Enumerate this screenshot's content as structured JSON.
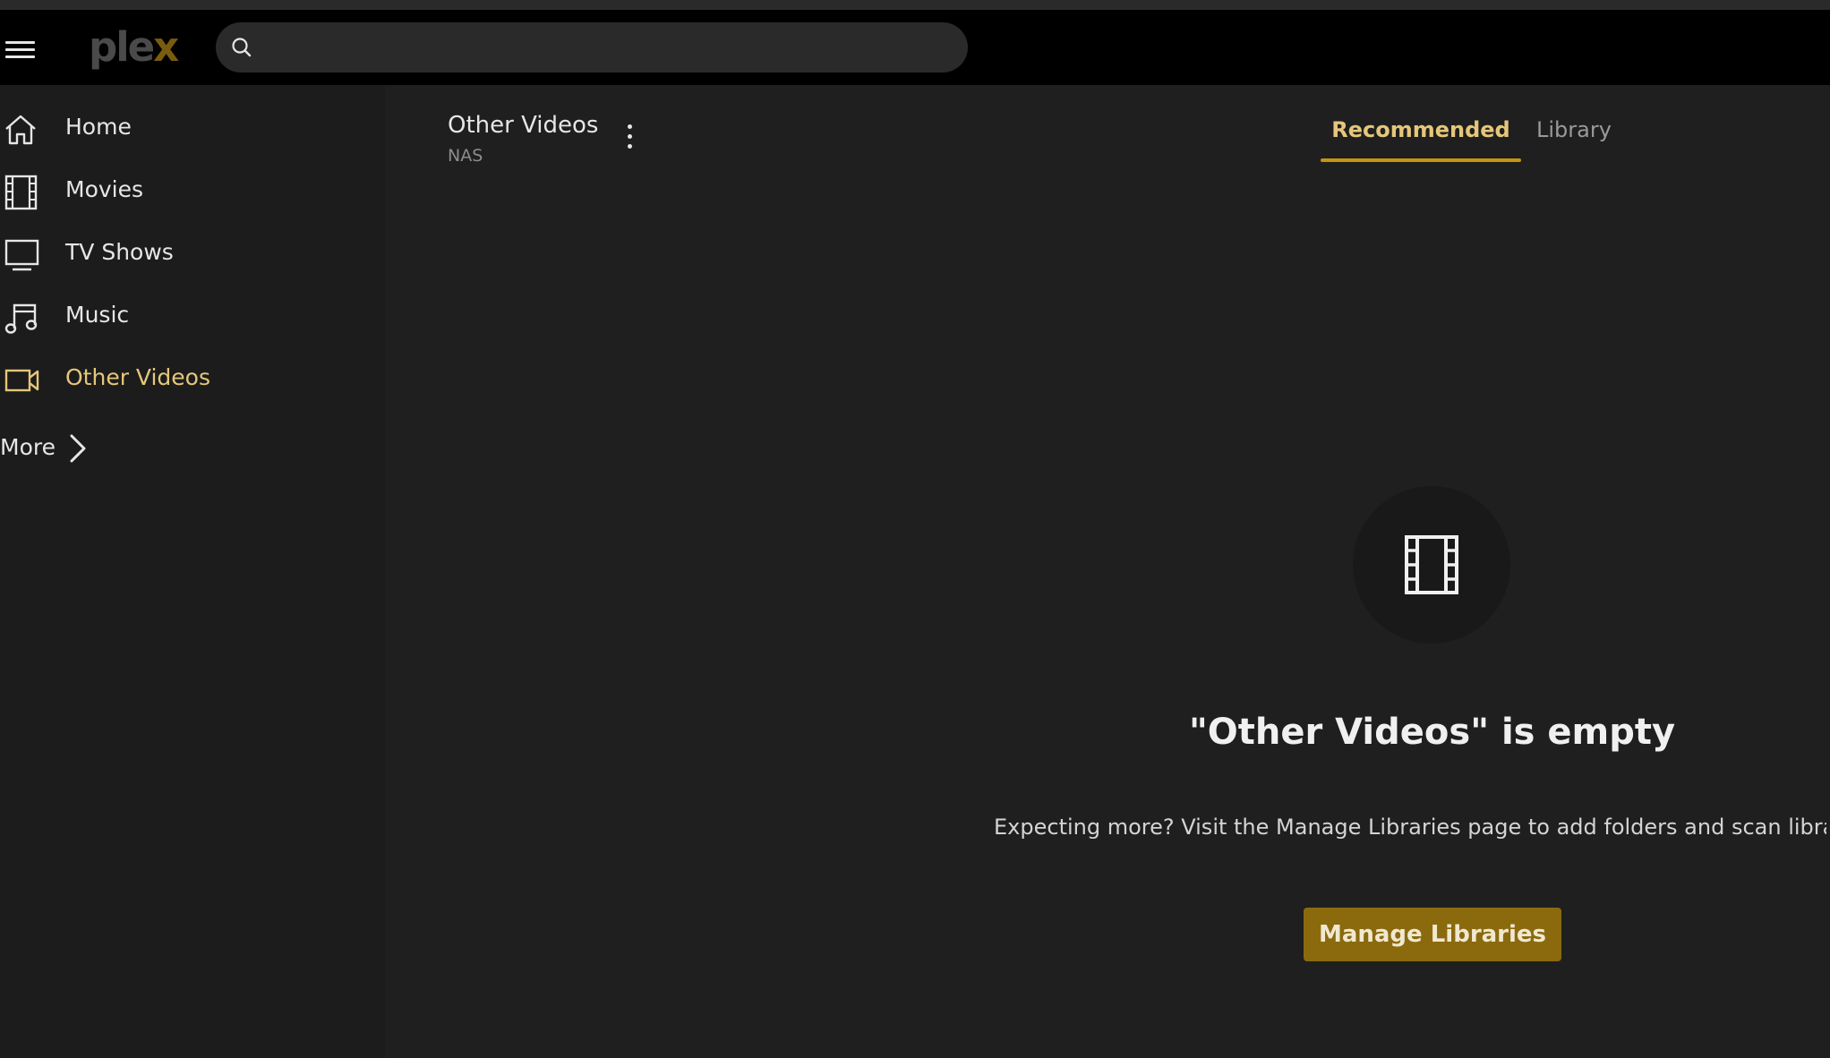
{
  "header": {
    "logo_main": "ple",
    "logo_accent": "x",
    "search_placeholder": "",
    "search_value": ""
  },
  "sidebar": {
    "items": [
      {
        "label": "Home",
        "icon": "home-icon"
      },
      {
        "label": "Movies",
        "icon": "film-icon"
      },
      {
        "label": "TV Shows",
        "icon": "tv-icon"
      },
      {
        "label": "Music",
        "icon": "music-note-icon"
      },
      {
        "label": "Other Videos",
        "icon": "video-camera-icon",
        "active": true
      }
    ],
    "more_label": "More"
  },
  "main": {
    "library_title": "Other Videos",
    "library_subtitle": "NAS",
    "tabs": [
      {
        "label": "Recommended",
        "active": true
      },
      {
        "label": "Library",
        "active": false
      }
    ],
    "empty_title": "\"Other Videos\" is empty",
    "empty_description": "Expecting more? Visit the Manage Libraries page to add folders and scan library f",
    "manage_button_label": "Manage Libraries"
  },
  "colors": {
    "accent": "#e5c77a",
    "button": "#8b6a0e",
    "tab_underline": "#c49512",
    "background": "#1f1f1f",
    "topbar": "#000000"
  }
}
